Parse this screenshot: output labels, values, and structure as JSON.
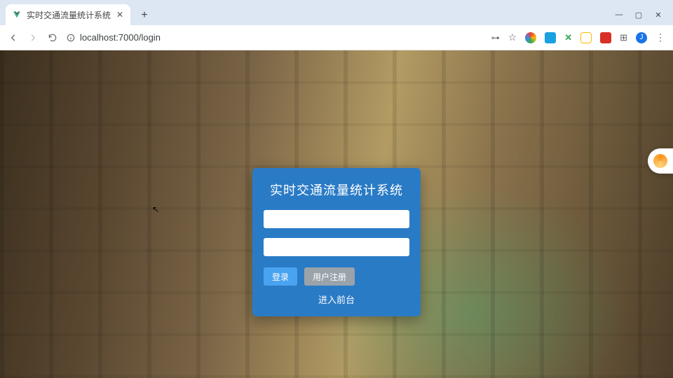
{
  "browser": {
    "tab_title": "实时交通流量统计系统",
    "url": "localhost:7000/login",
    "window_controls": {
      "min": "—",
      "max": "▢",
      "close": "✕"
    },
    "ext_colors": [
      "#ea4335",
      "#1aa1e1",
      "#34a853",
      "#fbbc05",
      "#d93025"
    ],
    "avatar_color": "#1a73e8",
    "avatar_letter": "J"
  },
  "login": {
    "title": "实时交通流量统计系统",
    "username_placeholder": "",
    "password_placeholder": "",
    "login_label": "登录",
    "register_label": "用户注册",
    "enter_front_label": "进入前台"
  },
  "colors": {
    "card_bg": "#2a7bc6",
    "primary_btn": "#4aa3f0",
    "secondary_btn": "#9aa3aa"
  }
}
